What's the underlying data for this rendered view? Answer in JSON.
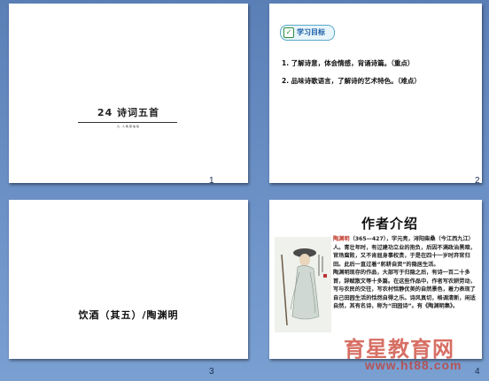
{
  "slides": [
    {
      "number": "1",
      "title": "24 诗词五首",
      "subtitle": "九·人教部编版"
    },
    {
      "number": "2",
      "badge": "学习目标",
      "items": [
        "1. 了解诗意，体会情感，背诵诗篇。（重点）",
        "2. 品味诗歌语言，了解诗的艺术特色。（难点）"
      ]
    },
    {
      "number": "3",
      "title": "饮酒（其五）/陶渊明"
    },
    {
      "number": "4",
      "heading": "作者介绍",
      "bio_name": "陶渊明",
      "bio_1": "（365—427），字元亮，浔阳柴桑（今江西九江）人。青壮年时，有过建功立业的抱负，后因不满政治黑暗，官场腐败，又不肯屈身事权贵，于是在四十一岁时弃官归田。此后一直过着“躬耕自资”的隐居生活。",
      "bio_2": "陶渊明现存的作品，大部写于归隐之后，有诗一百二十多首，辞赋散文等十多篇。在这些作品中，作者写农耕劳动，写与农民的交往，写农村恬静优美的自然景色，着力表现了自己田园生活的恬然自得之乐。诗风真切，格调清新，闲适自然，其有名诗，称为“田园诗”。有《陶渊明集》。"
    }
  ],
  "watermark": {
    "line1": "育星教育网",
    "line2": "www.ht88.com"
  },
  "colors": {
    "background": "#6b90c6",
    "highlight": "#c0392b",
    "badge_text": "#1b5ea6"
  }
}
